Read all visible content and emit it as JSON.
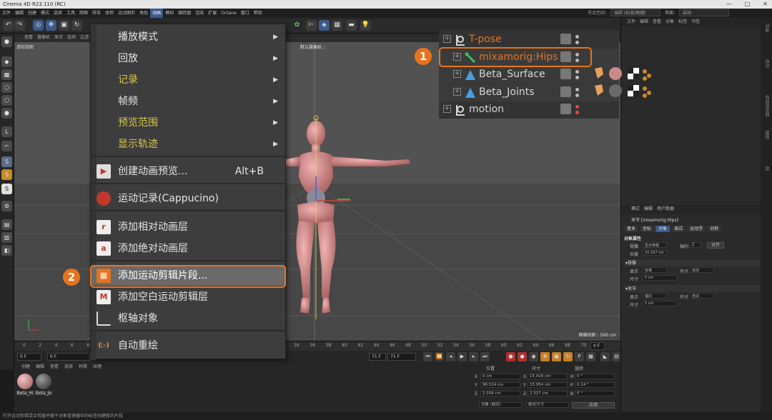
{
  "window": {
    "title": "Cinema 4D R23.110 (RC)",
    "controls": [
      "—",
      "□",
      "✕"
    ]
  },
  "menubar": [
    "文件",
    "编辑",
    "创建",
    "模式",
    "选择",
    "工具",
    "网格",
    "样条",
    "体积",
    "运动图形",
    "角色",
    "动画",
    "模拟",
    "跟踪器",
    "渲染",
    "扩展",
    "Octane",
    "窗口",
    "帮助"
  ],
  "menubar_active_index": 11,
  "layout": {
    "node_space_label": "节点空间:",
    "node_space_value": "当前 (标准/物理)",
    "layout_label": "界面:",
    "layout_value": "启动"
  },
  "viewport": {
    "menu": [
      "查看",
      "摄像机",
      "显示",
      "选项",
      "过滤",
      "面板"
    ],
    "view_label": "透视视图",
    "camera_label": "默认摄像机 ::",
    "grid_label": "网格间距 : 500 cm"
  },
  "timeline": {
    "ticks": [
      "0",
      "2",
      "4",
      "6",
      "8",
      "10",
      "12",
      "14",
      "16",
      "18",
      "20",
      "22",
      "24",
      "26",
      "28",
      "30",
      "32",
      "34",
      "36",
      "38",
      "40",
      "42",
      "44",
      "46",
      "48",
      "50",
      "52",
      "54",
      "56",
      "58",
      "60",
      "62",
      "64",
      "66",
      "68",
      "70"
    ],
    "current_frame": "0 F",
    "start_field": "0 F",
    "end_field_a": "71 F",
    "end_field_b": "71 F",
    "frame_badge": "0 F"
  },
  "material_manager": {
    "menu": [
      "创建",
      "编辑",
      "查看",
      "选择",
      "材质",
      "纹理"
    ],
    "materials": [
      {
        "label": "Beta_Hi",
        "color": "#c98a8a"
      },
      {
        "label": "Beta_Jo",
        "color": "#5a5a5a"
      }
    ]
  },
  "coordinates": {
    "headers": [
      "位置",
      "尺寸",
      "旋转"
    ],
    "rows": [
      {
        "axis": "X",
        "pos": "0 cm",
        "size_axis": "X",
        "size": "15.416 cm",
        "rot_axis": "H",
        "rot": "0 °"
      },
      {
        "axis": "Y",
        "pos": "96.514 cm",
        "size_axis": "Y",
        "size": "15.954 cm",
        "rot_axis": "P",
        "rot": "0.14 °"
      },
      {
        "axis": "Z",
        "pos": "1.034 cm",
        "size_axis": "Z",
        "size": "2.327 cm",
        "rot_axis": "B",
        "rot": "0 °"
      }
    ],
    "mode_a": "对象 (相对)",
    "mode_b": "绝对尺寸",
    "apply_label": "应用"
  },
  "statusbar": "打开运动剪辑混合视窗并基于对象管理器中的标签创建新的片段",
  "object_manager": {
    "menu": [
      "文件",
      "编辑",
      "查看",
      "对象",
      "标签",
      "书签"
    ]
  },
  "object_overlay": {
    "rows": [
      {
        "name": "T-pose",
        "color": "#e8731d",
        "indent": 0,
        "dots": [
          "#bbb",
          "#bbb"
        ]
      },
      {
        "name": "mixamorig:Hips",
        "color": "#e8731d",
        "indent": 1,
        "dots": [
          "#bbb",
          "#bbb"
        ]
      },
      {
        "name": "Beta_Surface",
        "color": "#d8d8d8",
        "indent": 1,
        "dots": [
          "#bbb",
          "#bbb"
        ]
      },
      {
        "name": "Beta_Joints",
        "color": "#d8d8d8",
        "indent": 1,
        "dots": [
          "#bbb",
          "#bbb"
        ]
      },
      {
        "name": "motion",
        "color": "#d8d8d8",
        "indent": 0,
        "dots": [
          "#e24a4a",
          "#e24a4a"
        ]
      }
    ]
  },
  "attribute_manager": {
    "menu": [
      "模式",
      "编辑",
      "用户数据"
    ],
    "title": "关节 [mixamorig:Hips]",
    "tabs": [
      "基本",
      "坐标",
      "对象",
      "调试",
      "运动学",
      "对称"
    ],
    "active_tab_index": 2,
    "section_object": "对象属性",
    "fields": [
      {
        "label": "骨骼",
        "value": "显示骨骼",
        "extra_label": "轴向",
        "extra": "Z"
      },
      {
        "label": "长度",
        "value": "10.167 cm"
      }
    ],
    "align_button": "对齐",
    "section_bones": "▾骨骼",
    "bone_fields": [
      {
        "label": "显示",
        "value": "标准",
        "extra_label": "尺寸",
        "extra": "自动"
      },
      {
        "label": "尺寸",
        "value": "5 cm"
      }
    ],
    "section_joints": "▾关节",
    "joint_fields": [
      {
        "label": "显示",
        "value": "轴向",
        "extra_label": "尺寸",
        "extra": "自动"
      },
      {
        "label": "尺寸",
        "value": "5 cm"
      }
    ]
  },
  "right_strip": [
    "对象",
    "场次",
    "内容浏览器",
    "属性",
    "层"
  ],
  "dropdown": {
    "items": [
      {
        "label": "播放模式",
        "submenu": true,
        "color": "#e6e6e6"
      },
      {
        "label": "回放",
        "submenu": true,
        "color": "#e6e6e6"
      },
      {
        "label": "记录",
        "submenu": true,
        "color": "#d7c84a"
      },
      {
        "label": "帧频",
        "submenu": true,
        "color": "#e6e6e6"
      },
      {
        "label": "预览范围",
        "submenu": true,
        "color": "#d7c84a"
      },
      {
        "label": "显示轨迹",
        "submenu": true,
        "color": "#d7c84a"
      },
      {
        "label": "创建动画预览...",
        "shortcut": "Alt+B",
        "color": "#e6e6e6",
        "icon": "preview-icon"
      },
      {
        "label": "运动记录(Cappucino)",
        "color": "#e6e6e6",
        "icon": "motion-record-icon"
      },
      {
        "label": "添加相对动画层",
        "color": "#e6e6e6",
        "icon": "relative-layer-icon"
      },
      {
        "label": "添加绝对动画层",
        "color": "#e6e6e6",
        "icon": "absolute-layer-icon"
      },
      {
        "label": "添加运动剪辑片段...",
        "color": "#ffffff",
        "icon": "motion-clip-icon",
        "highlighted": true
      },
      {
        "label": "添加空白运动剪辑层",
        "color": "#e6e6e6",
        "icon": "blank-clip-layer-icon"
      },
      {
        "label": "枢轴对象",
        "color": "#e6e6e6",
        "icon": "pivot-object-icon"
      },
      {
        "label": "自动重绘",
        "color": "#e6e6e6",
        "icon": "auto-redraw-icon"
      }
    ]
  },
  "annotations": [
    "1",
    "2"
  ],
  "colors": {
    "accent": "#e8731d",
    "highlight_row": "#6a6a6a",
    "menu_bg": "#3d3d3d"
  }
}
